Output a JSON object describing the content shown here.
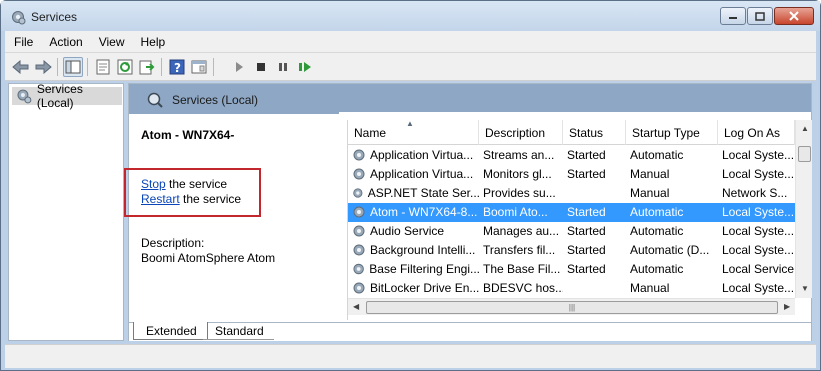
{
  "window": {
    "title": "Services"
  },
  "menu": [
    "File",
    "Action",
    "View",
    "Help"
  ],
  "tree": {
    "root": "Services (Local)"
  },
  "pane": {
    "header": "Services (Local)",
    "service_name": "Atom - WN7X64-",
    "stop_link": "Stop",
    "stop_suffix": " the service",
    "restart_link": "Restart",
    "restart_suffix": " the service",
    "description_label": "Description:",
    "description_value": "Boomi AtomSphere Atom"
  },
  "table": {
    "columns": [
      "Name",
      "Description",
      "Status",
      "Startup Type",
      "Log On As"
    ],
    "rows": [
      {
        "name": "Application Virtua...",
        "description": "Streams an...",
        "status": "Started",
        "startup": "Automatic",
        "logon": "Local Syste...",
        "selected": false
      },
      {
        "name": "Application Virtua...",
        "description": "Monitors gl...",
        "status": "Started",
        "startup": "Manual",
        "logon": "Local Syste...",
        "selected": false
      },
      {
        "name": "ASP.NET State Ser...",
        "description": "Provides su...",
        "status": "",
        "startup": "Manual",
        "logon": "Network S...",
        "selected": false
      },
      {
        "name": "Atom - WN7X64-8...",
        "description": "Boomi Ato...",
        "status": "Started",
        "startup": "Automatic",
        "logon": "Local Syste...",
        "selected": true
      },
      {
        "name": "Audio Service",
        "description": "Manages au...",
        "status": "Started",
        "startup": "Automatic",
        "logon": "Local Syste...",
        "selected": false
      },
      {
        "name": "Background Intelli...",
        "description": "Transfers fil...",
        "status": "Started",
        "startup": "Automatic (D...",
        "logon": "Local Syste...",
        "selected": false
      },
      {
        "name": "Base Filtering Engi...",
        "description": "The Base Fil...",
        "status": "Started",
        "startup": "Automatic",
        "logon": "Local Service",
        "selected": false
      },
      {
        "name": "BitLocker Drive En...",
        "description": "BDESVC hos...",
        "status": "",
        "startup": "Manual",
        "logon": "Local Syste...",
        "selected": false
      },
      {
        "name": "...",
        "description": "...",
        "status": "",
        "startup": "",
        "logon": "",
        "selected": false
      }
    ]
  },
  "tabs": {
    "extended": "Extended",
    "standard": "Standard"
  },
  "colors": {
    "selection": "#3399ff",
    "link": "#0a46b8",
    "highlight_box": "#c1272d"
  },
  "icons": {
    "toolbar": [
      "back-icon",
      "forward-icon",
      "show-tree-icon",
      "properties-icon",
      "refresh-icon",
      "export-icon",
      "help-icon",
      "console-icon",
      "play-icon",
      "stop-icon",
      "pause-icon",
      "resume-icon"
    ]
  }
}
